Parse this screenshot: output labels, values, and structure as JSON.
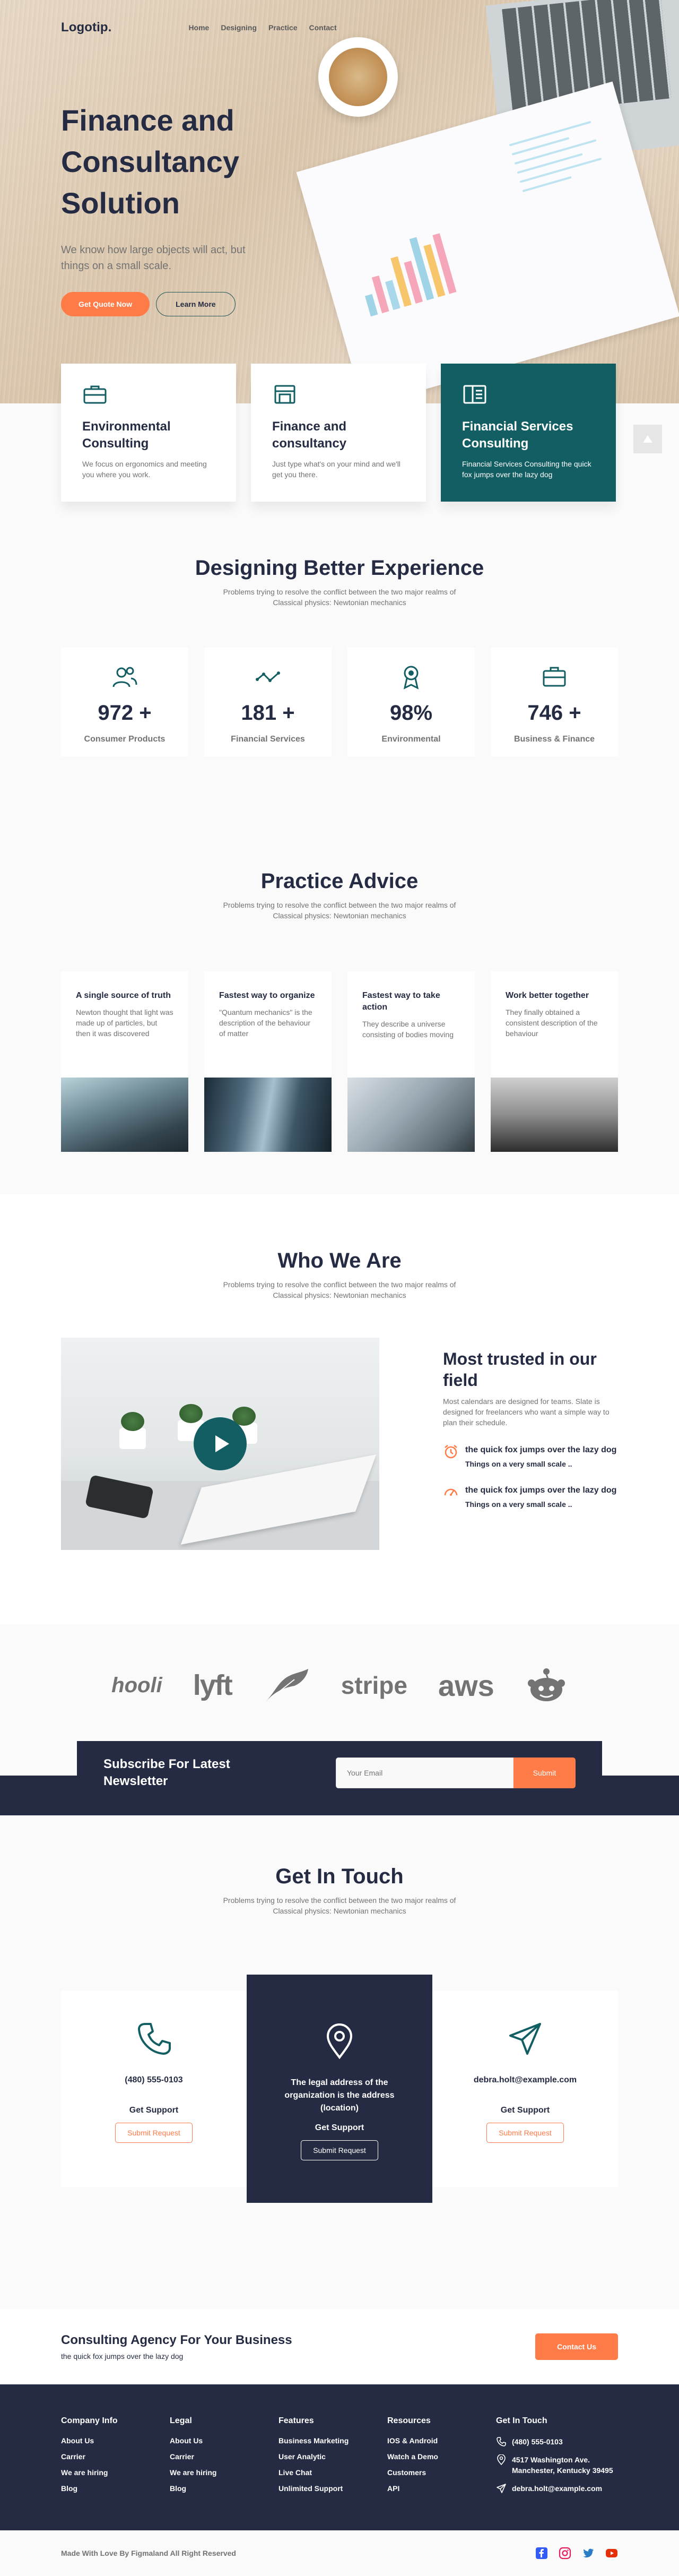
{
  "nav": {
    "logo": "Logotip.",
    "links": [
      "Home",
      "Designing",
      "Practice",
      "Contact"
    ]
  },
  "hero": {
    "title": "Finance and Consultancy Solution",
    "subtitle": "We know how large objects will act, but things on a small scale.",
    "primary_button": "Get Quote Now",
    "secondary_button": "Learn More"
  },
  "features": [
    {
      "title": "Environmental Consulting",
      "text": "We focus on ergonomics and meeting you where you work.",
      "icon": "briefcase-icon"
    },
    {
      "title": "Finance and consultancy",
      "text": "Just type what's on your mind and we'll get you there.",
      "icon": "storefront-icon"
    },
    {
      "title": "Financial Services Consulting",
      "text": "Financial Services Consulting the quick fox jumps over the lazy dog",
      "icon": "book-icon"
    }
  ],
  "stats": {
    "title": "Designing Better Experience",
    "subtitle": "Problems trying to resolve the conflict between the two major realms of Classical physics: Newtonian mechanics",
    "items": [
      {
        "value": "972 +",
        "label": "Consumer Products",
        "icon": "users-icon"
      },
      {
        "value": "181 +",
        "label": "Financial Services",
        "icon": "trend-icon"
      },
      {
        "value": "98%",
        "label": "Environmental",
        "icon": "award-icon"
      },
      {
        "value": "746 +",
        "label": "Business & Finance",
        "icon": "briefcase-icon"
      }
    ]
  },
  "practice": {
    "title": "Practice Advice",
    "subtitle": "Problems trying to resolve the conflict between the two major realms of Classical physics: Newtonian mechanics",
    "items": [
      {
        "title": "A single source of truth",
        "text": "Newton thought that light was made up of particles, but then it was discovered"
      },
      {
        "title": "Fastest way to organize",
        "text": "\"Quantum mechanics\" is the description of the behaviour of matter"
      },
      {
        "title": "Fastest way to take action",
        "text": "They describe a universe consisting of bodies moving"
      },
      {
        "title": "Work better together",
        "text": "They finally obtained a consistent description of the behaviour"
      }
    ]
  },
  "who": {
    "title": "Who We Are",
    "subtitle": "Problems trying to resolve the conflict between the two major realms of Classical physics: Newtonian mechanics",
    "heading": "Most trusted in our field",
    "text": "Most calendars are designed for teams. Slate is designed for freelancers who want a simple way to plan their schedule.",
    "items": [
      {
        "title": "the quick fox jumps over the lazy dog",
        "text": "Things on a very small scale ..",
        "icon": "alarm-icon"
      },
      {
        "title": "the quick fox jumps over the lazy dog",
        "text": "Things on a very small scale ..",
        "icon": "gauge-icon"
      }
    ]
  },
  "brands": [
    "hooli",
    "lyft",
    "feather",
    "stripe",
    "aws",
    "reddit"
  ],
  "newsletter": {
    "title": "Subscribe For Latest Newsletter",
    "placeholder": "Your Email",
    "button": "Submit"
  },
  "contact": {
    "title": "Get In Touch",
    "subtitle": "Problems trying to resolve the conflict between the two major realms of Classical physics: Newtonian mechanics",
    "cards": [
      {
        "text": "(480) 555-0103",
        "label": "Get Support",
        "button": "Submit Request",
        "icon": "phone-icon"
      },
      {
        "text": "The legal address of the organization is the address (location)",
        "label": "Get Support",
        "button": "Submit Request",
        "icon": "location-pin-icon"
      },
      {
        "text": "debra.holt@example.com",
        "label": "Get Support",
        "button": "Submit Request",
        "icon": "send-icon"
      }
    ]
  },
  "cta": {
    "title": "Consulting Agency For Your Business",
    "text": "the quick fox jumps over the lazy dog",
    "button": "Contact Us"
  },
  "footer": {
    "columns": [
      {
        "heading": "Company Info",
        "links": [
          "About Us",
          "Carrier",
          "We are hiring",
          "Blog"
        ]
      },
      {
        "heading": "Legal",
        "links": [
          "About Us",
          "Carrier",
          "We are hiring",
          "Blog"
        ]
      },
      {
        "heading": "Features",
        "links": [
          "Business Marketing",
          "User Analytic",
          "Live Chat",
          "Unlimited Support"
        ]
      },
      {
        "heading": "Resources",
        "links": [
          "IOS & Android",
          "Watch a Demo",
          "Customers",
          "API"
        ]
      }
    ],
    "contact": {
      "heading": "Get In Touch",
      "phone": "(480) 555-0103",
      "address": "4517 Washington Ave. Manchester, Kentucky 39495",
      "email": "debra.holt@example.com"
    },
    "copyright": "Made With Love By Figmaland All Right Reserved",
    "socials": [
      "facebook-icon",
      "instagram-icon",
      "twitter-icon",
      "youtube-icon"
    ]
  },
  "colors": {
    "primary": "#252B42",
    "accent": "#FF7B47",
    "teal": "#125E62",
    "muted": "#737373"
  }
}
